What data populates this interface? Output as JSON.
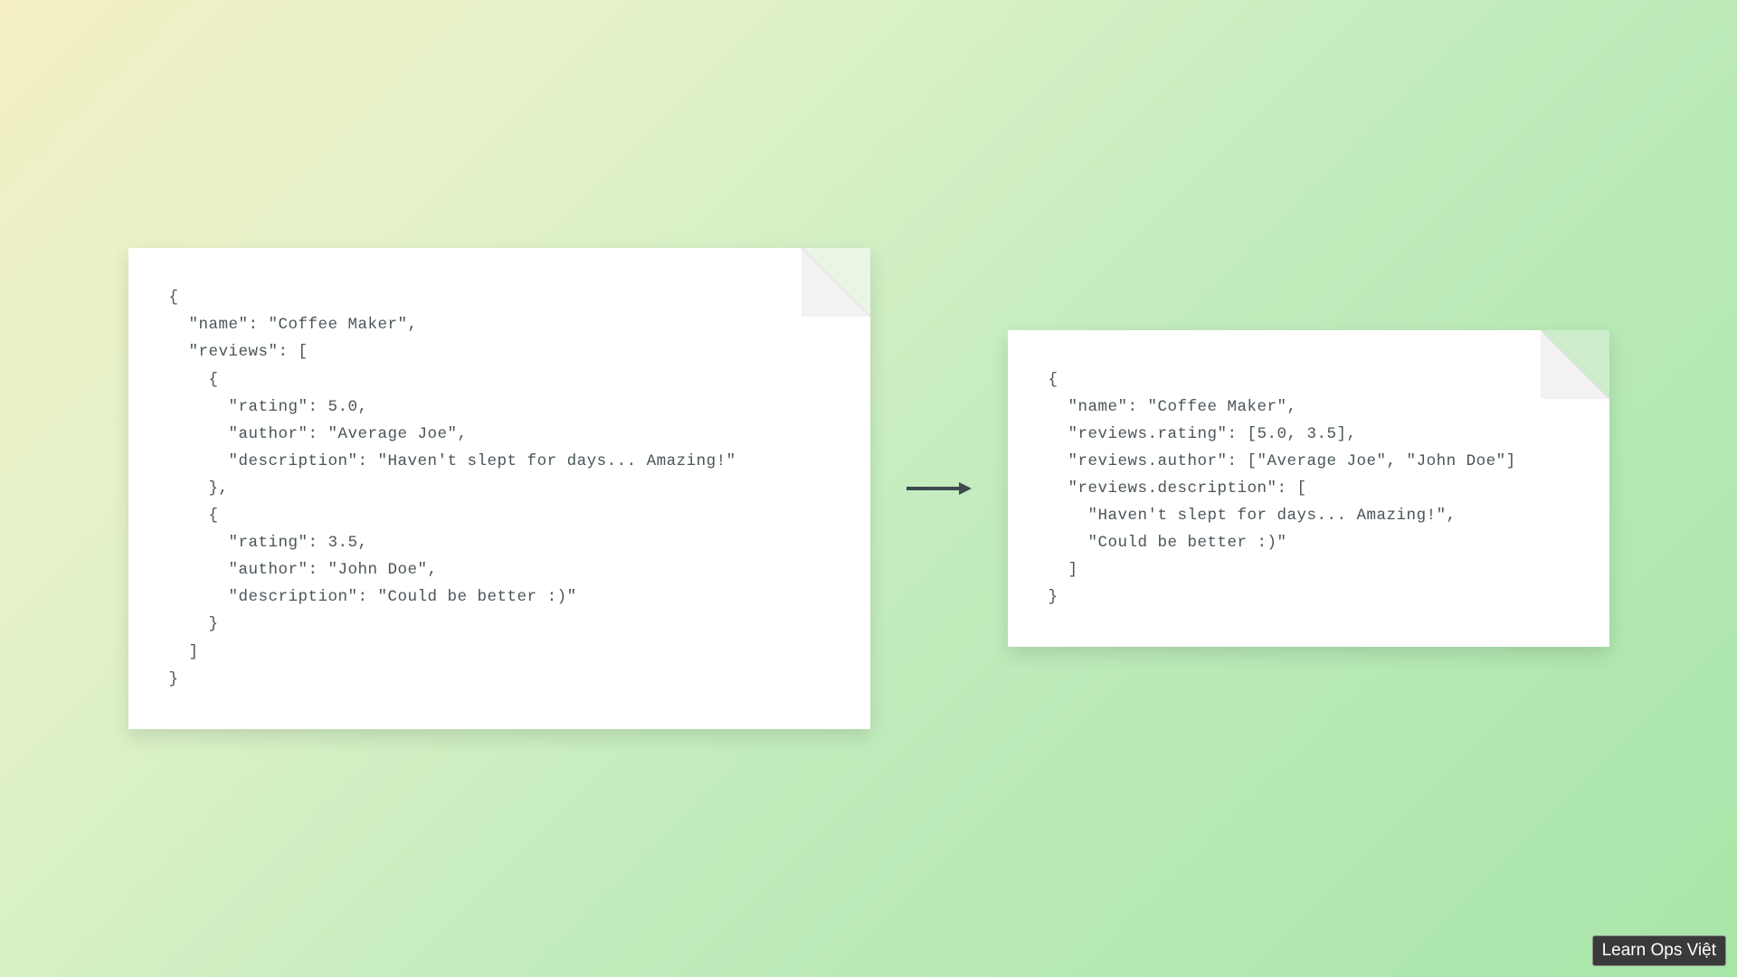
{
  "code_left": "{\n  \"name\": \"Coffee Maker\",\n  \"reviews\": [\n    {\n      \"rating\": 5.0,\n      \"author\": \"Average Joe\",\n      \"description\": \"Haven't slept for days... Amazing!\"\n    },\n    {\n      \"rating\": 3.5,\n      \"author\": \"John Doe\",\n      \"description\": \"Could be better :)\"\n    }\n  ]\n}",
  "code_right": "{\n  \"name\": \"Coffee Maker\",\n  \"reviews.rating\": [5.0, 3.5],\n  \"reviews.author\": [\"Average Joe\", \"John Doe\"]\n  \"reviews.description\": [\n    \"Haven't slept for days... Amazing!\",\n    \"Could be better :)\"\n  ]\n}",
  "watermark": "Learn Ops Việt"
}
